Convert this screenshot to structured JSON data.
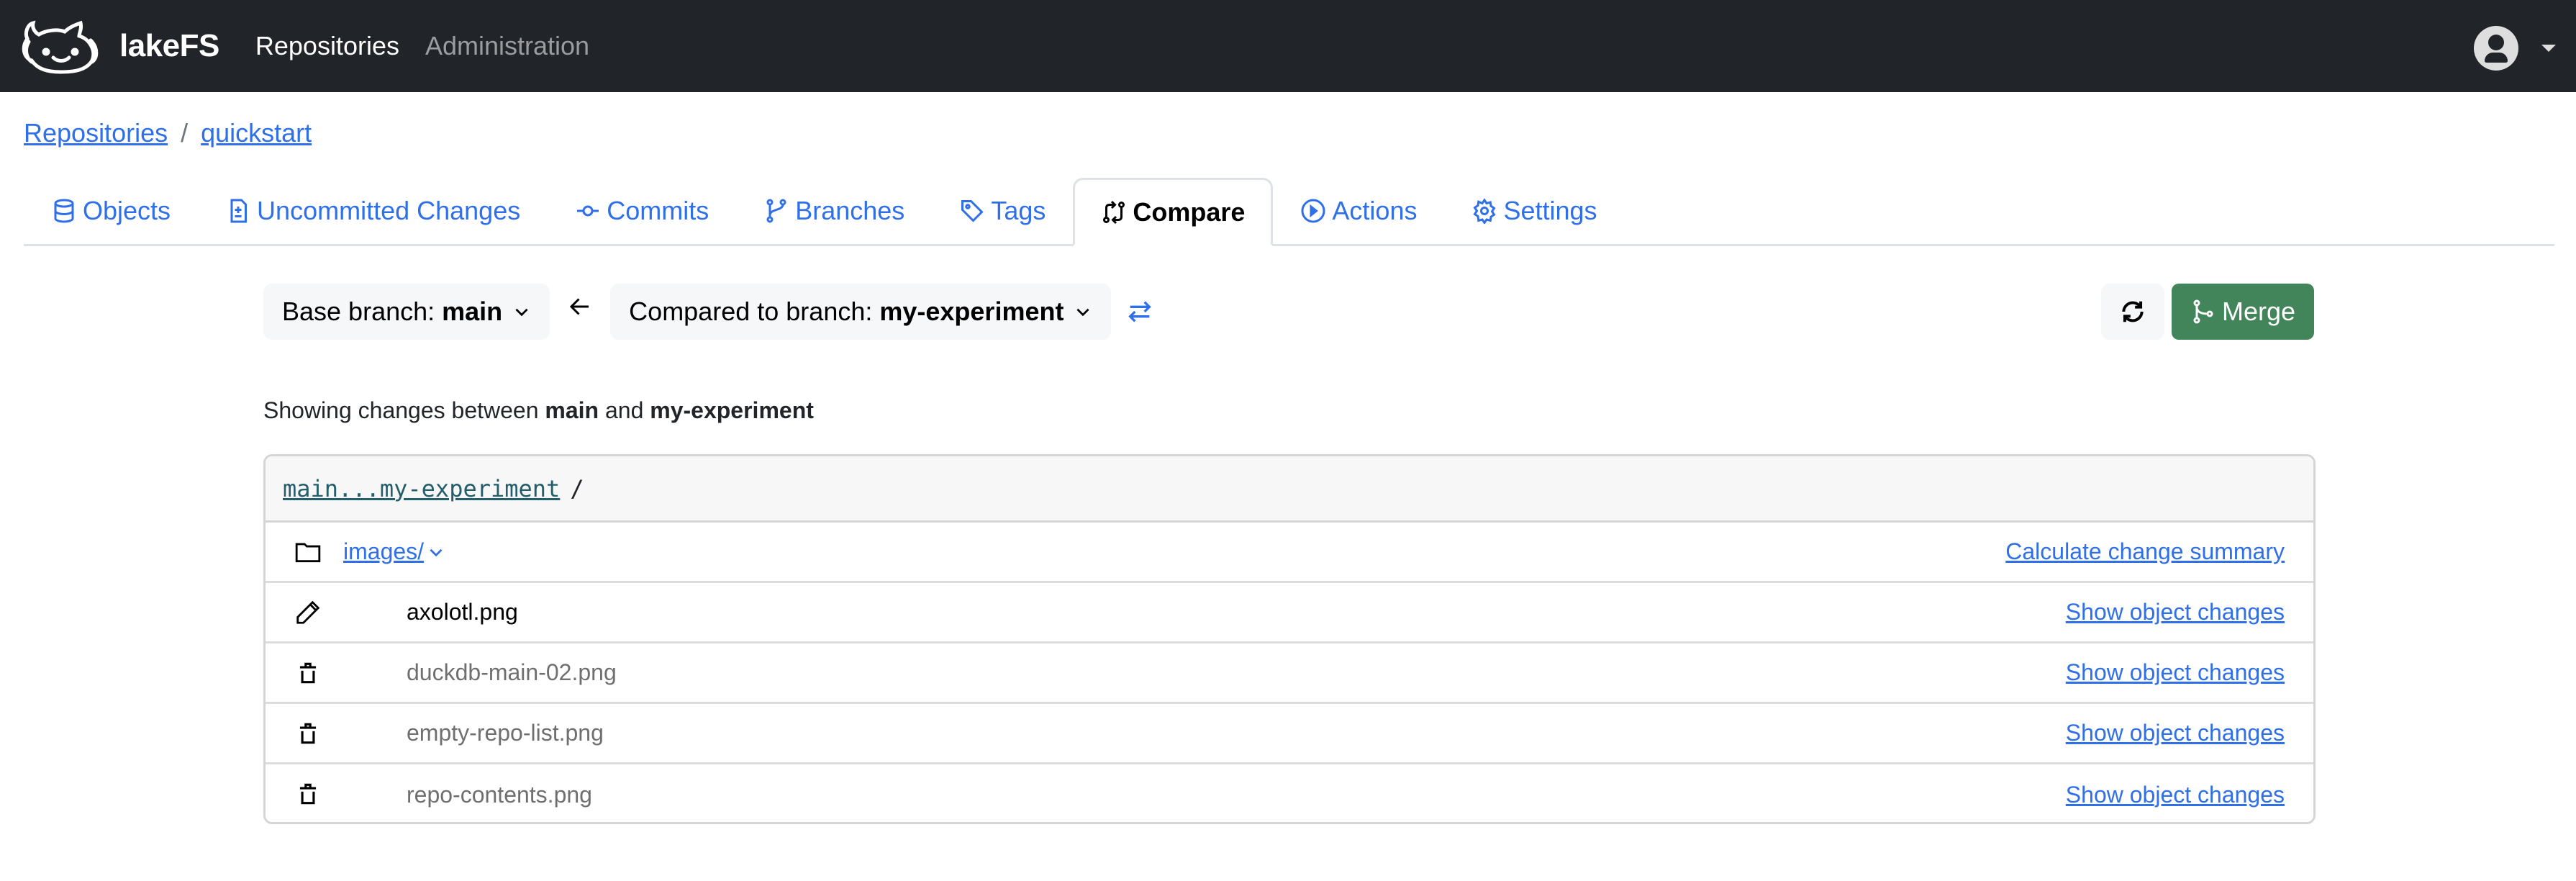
{
  "navbar": {
    "brand": "lakeFS",
    "links": [
      {
        "label": "Repositories",
        "active": true
      },
      {
        "label": "Administration",
        "active": false
      }
    ],
    "user_icon": "user-circle-icon"
  },
  "breadcrumb": {
    "items": [
      "Repositories",
      "quickstart"
    ],
    "separator": "/"
  },
  "tabs": [
    {
      "label": "Objects",
      "icon": "database-icon",
      "active": false
    },
    {
      "label": "Uncommitted Changes",
      "icon": "file-diff-icon",
      "active": false
    },
    {
      "label": "Commits",
      "icon": "git-commit-icon",
      "active": false
    },
    {
      "label": "Branches",
      "icon": "git-branch-icon",
      "active": false
    },
    {
      "label": "Tags",
      "icon": "tag-icon",
      "active": false
    },
    {
      "label": "Compare",
      "icon": "git-compare-icon",
      "active": true
    },
    {
      "label": "Actions",
      "icon": "play-icon",
      "active": false
    },
    {
      "label": "Settings",
      "icon": "gear-icon",
      "active": false
    }
  ],
  "compare": {
    "base_label": "Base branch:",
    "base_value": "main",
    "compared_label": "Compared to branch:",
    "compared_value": "my-experiment",
    "merge_label": "Merge"
  },
  "summary": {
    "prefix": "Showing changes between",
    "base": "main",
    "conj": "and",
    "compared": "my-experiment"
  },
  "changes": {
    "header_ref": "main...my-experiment",
    "header_path": "/",
    "folder": {
      "name": "images/",
      "action": "Calculate change summary"
    },
    "rows": [
      {
        "name": "axolotl.png",
        "type": "changed",
        "icon": "pencil-icon",
        "action": "Show object changes"
      },
      {
        "name": "duckdb-main-02.png",
        "type": "removed",
        "icon": "trash-icon",
        "action": "Show object changes"
      },
      {
        "name": "empty-repo-list.png",
        "type": "removed",
        "icon": "trash-icon",
        "action": "Show object changes"
      },
      {
        "name": "repo-contents.png",
        "type": "removed",
        "icon": "trash-icon",
        "action": "Show object changes"
      }
    ]
  },
  "colors": {
    "navbar_bg": "#212529",
    "link": "#2f6fe8",
    "merge_green": "#42855b",
    "mono_link": "#255e6b"
  }
}
